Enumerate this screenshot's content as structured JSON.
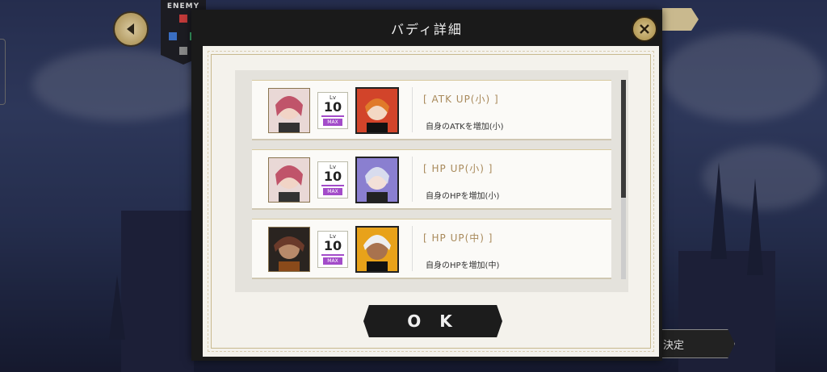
{
  "hud": {
    "enemy_label": "ENEMY",
    "decide_label": "決定"
  },
  "modal": {
    "title": "バディ詳細",
    "ok_label": "O K"
  },
  "buddies": [
    {
      "level_caption": "Lv",
      "level": "10",
      "max_badge": "MAX",
      "skill_name": "[ ATK UP(小) ]",
      "skill_desc": "自身のATKを増加(小)",
      "left_color": "#c0546a",
      "right_color": "#d2442a"
    },
    {
      "level_caption": "Lv",
      "level": "10",
      "max_badge": "MAX",
      "skill_name": "[ HP UP(小) ]",
      "skill_desc": "自身のHPを増加(小)",
      "left_color": "#c0546a",
      "right_color": "#8a7fd0"
    },
    {
      "level_caption": "Lv",
      "level": "10",
      "max_badge": "MAX",
      "skill_name": "[ HP UP(中) ]",
      "skill_desc": "自身のHPを増加(中)",
      "left_color": "#6a3a2a",
      "right_color": "#e8a21a"
    }
  ],
  "scroll": {
    "position_fraction": 0.0
  }
}
